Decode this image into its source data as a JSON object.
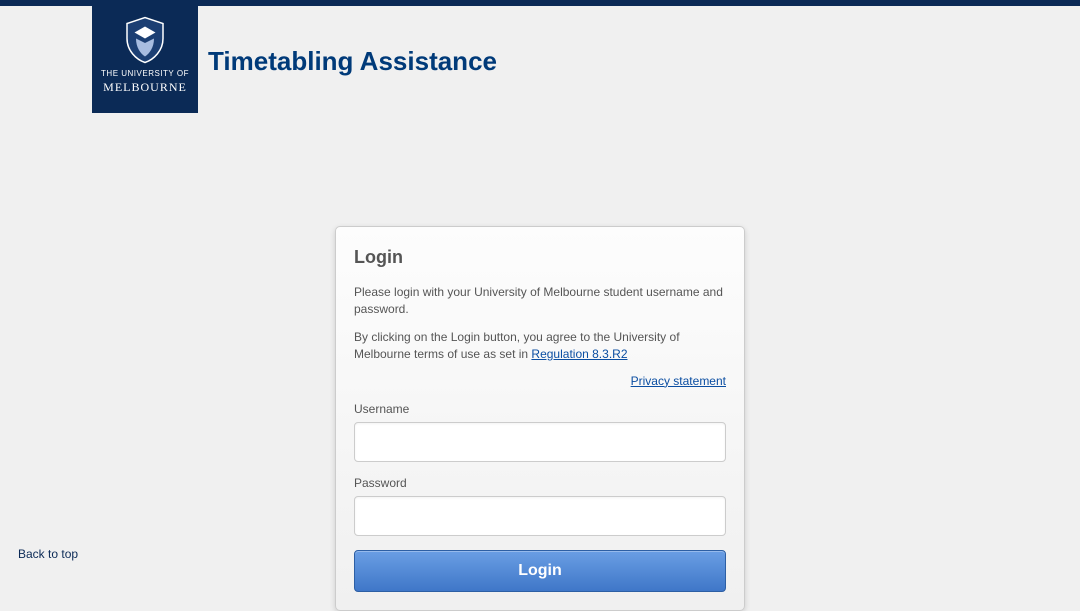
{
  "header": {
    "title": "Timetabling Assistance",
    "logo_line1": "THE UNIVERSITY OF",
    "logo_line2": "MELBOURNE"
  },
  "login": {
    "heading": "Login",
    "intro": "Please login with your University of Melbourne student username and password.",
    "terms_prefix": "By clicking on the Login button, you agree to the University of Melbourne terms of use as set in ",
    "terms_link_label": "Regulation 8.3.R2",
    "privacy_link_label": "Privacy statement",
    "username_label": "Username",
    "username_value": "",
    "password_label": "Password",
    "password_value": "",
    "button_label": "Login"
  },
  "footer": {
    "back_to_top": "Back to top"
  }
}
